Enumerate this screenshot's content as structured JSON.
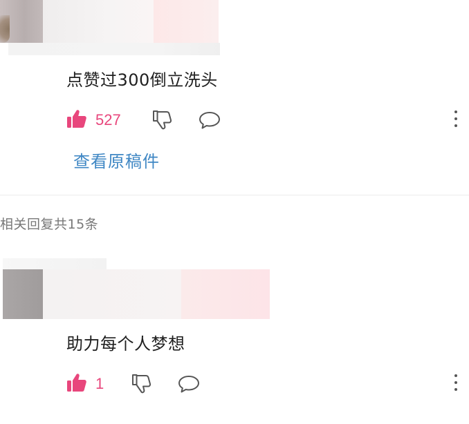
{
  "main_comment": {
    "text": "点赞过300倒立洗头",
    "like_count": "527",
    "view_original_label": "查看原稿件"
  },
  "replies_summary": "相关回复共15条",
  "reply_comment": {
    "text": "助力每个人梦想",
    "like_count": "1"
  },
  "icons": {
    "like": "thumbs-up-icon",
    "dislike": "thumbs-down-icon",
    "reply": "speech-bubble-icon",
    "more": "more-vertical-icon"
  },
  "colors": {
    "like_accent": "#e8467c",
    "link": "#3f87c4",
    "icon_gray": "#555555",
    "text": "#1f1f1f",
    "secondary_text": "#777777"
  }
}
